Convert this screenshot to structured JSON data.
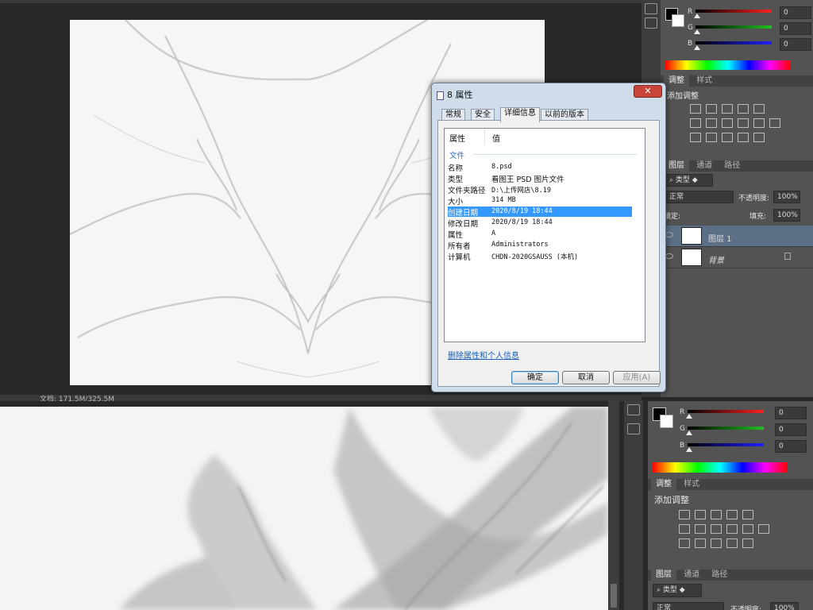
{
  "top_panel": {
    "rgb": [
      {
        "label": "R",
        "value": "0",
        "color": "#ff2020"
      },
      {
        "label": "G",
        "value": "0",
        "color": "#20c020"
      },
      {
        "label": "B",
        "value": "0",
        "color": "#2020ff"
      }
    ],
    "tabs": {
      "adjust": "调整",
      "styles": "样式"
    },
    "add_adjust": "添加调整",
    "layer_tabs": {
      "layers": "图层",
      "channels": "通道",
      "paths": "路径"
    },
    "kind": "类型",
    "blend": "正常",
    "opacity_label": "不透明度:",
    "opacity_value": "100%",
    "lock_label": "锁定:",
    "fill_label": "填充:",
    "fill_value": "100%",
    "layers": [
      {
        "name": "图层 1"
      },
      {
        "name": "背景"
      }
    ]
  },
  "status1": "文档: 171.5M/325.5M",
  "dialog": {
    "title": "8 属性",
    "close": "✕",
    "tabs": [
      "常规",
      "安全",
      "详细信息",
      "以前的版本"
    ],
    "col_property": "属性",
    "col_value": "值",
    "group": "文件",
    "rows": [
      {
        "k": "名称",
        "v": "8.psd"
      },
      {
        "k": "类型",
        "v": "看图王 PSD 图片文件"
      },
      {
        "k": "文件夹路径",
        "v": "D:\\上传网店\\8.19"
      },
      {
        "k": "大小",
        "v": "314 MB"
      },
      {
        "k": "创建日期",
        "v": "2020/8/19 18:44"
      },
      {
        "k": "修改日期",
        "v": "2020/8/19 18:44"
      },
      {
        "k": "属性",
        "v": "A"
      },
      {
        "k": "所有者",
        "v": "Administrators"
      },
      {
        "k": "计算机",
        "v": "CHDN-2020GSAUSS (本机)"
      }
    ],
    "selected_row": 4,
    "remove_link": "删除属性和个人信息",
    "ok": "确定",
    "cancel": "取消",
    "apply": "应用(A)"
  },
  "bottom_panel": {
    "rgb": [
      {
        "label": "R",
        "value": "0",
        "color": "#ff2020"
      },
      {
        "label": "G",
        "value": "0",
        "color": "#20c020"
      },
      {
        "label": "B",
        "value": "0",
        "color": "#2020ff"
      }
    ],
    "tabs": {
      "adjust": "调整",
      "styles": "样式"
    },
    "add_adjust": "添加调整",
    "layer_tabs": {
      "layers": "图层",
      "channels": "通道",
      "paths": "路径"
    },
    "kind": "类型",
    "blend": "正常",
    "opacity_label": "不透明度:",
    "opacity_value": "100%"
  }
}
